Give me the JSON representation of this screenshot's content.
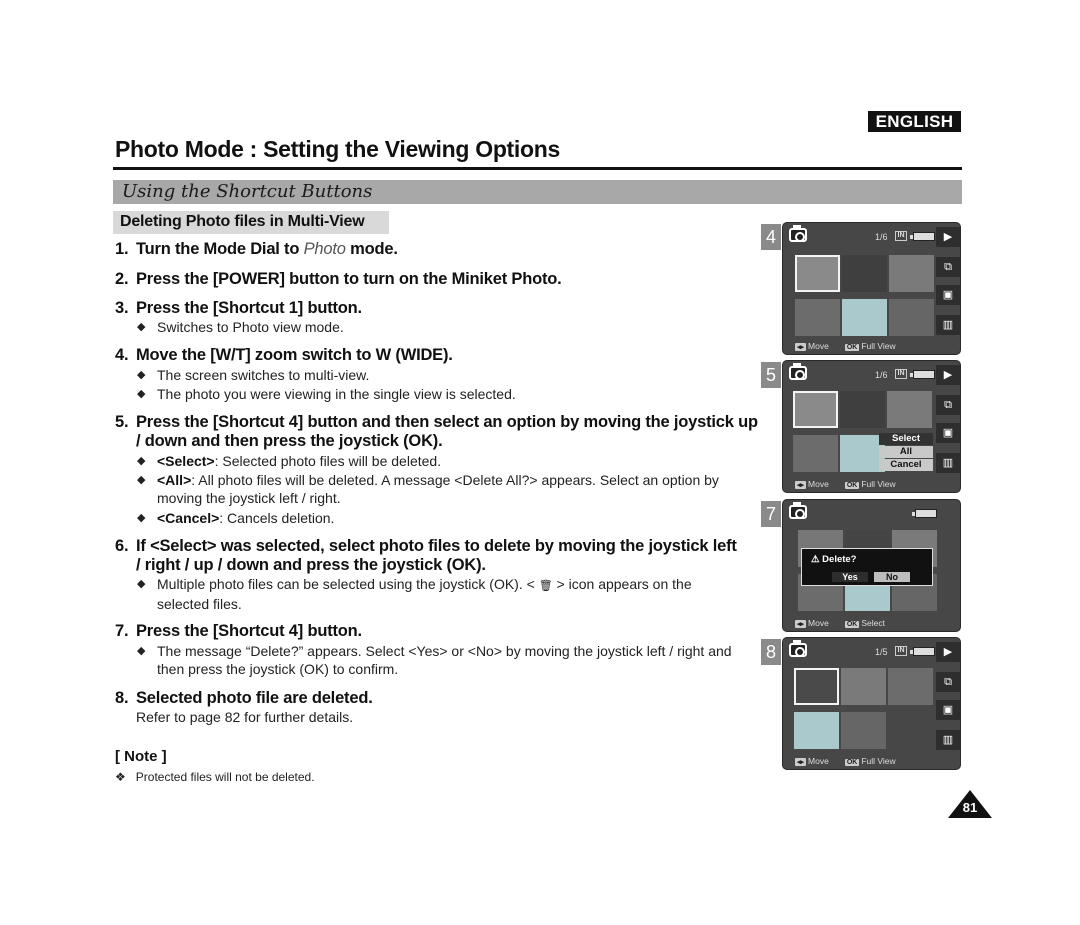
{
  "header": {
    "language_badge": "ENGLISH",
    "title": "Photo Mode : Setting the Viewing Options",
    "section": "Using the Shortcut Buttons",
    "subsection": "Deleting Photo files in Multi-View"
  },
  "steps": [
    {
      "num": "1.",
      "text_before": "Turn the Mode Dial to ",
      "text_italic": "Photo",
      "text_after": " mode."
    },
    {
      "num": "2.",
      "text": "Press the [POWER] button to turn on the Miniket Photo."
    },
    {
      "num": "3.",
      "text": "Press the [Shortcut 1] button.",
      "bullets": [
        {
          "text": "Switches to Photo view mode."
        }
      ]
    },
    {
      "num": "4.",
      "text": "Move the [W/T] zoom switch to W (WIDE).",
      "bullets": [
        {
          "text": "The screen switches to multi-view."
        },
        {
          "text": "The photo you were viewing in the single view is selected."
        }
      ]
    },
    {
      "num": "5.",
      "text": "Press the [Shortcut 4] button and then select an option by moving the joystick up / down and then press the joystick (OK).",
      "bullets": [
        {
          "bold": "<Select>",
          "text": ": Selected photo files will be deleted."
        },
        {
          "bold": "<All>",
          "text": ": All photo files will be deleted. A message <Delete All?> appears. Select an option by moving the joystick left / right."
        },
        {
          "bold": "<Cancel>",
          "text": ": Cancels deletion."
        }
      ]
    },
    {
      "num": "6.",
      "text": "If <Select> was selected, select photo files to delete by moving the joystick left / right / up / down and press the joystick (OK).",
      "bullets": [
        {
          "text_before": "Multiple photo files can be selected using the joystick (OK). < ",
          "icon": "trash-icon",
          "text_after": " > icon appears on the selected files."
        }
      ]
    },
    {
      "num": "7.",
      "text": "Press the [Shortcut 4] button.",
      "bullets": [
        {
          "text": "The message “Delete?” appears. Select <Yes> or <No> by moving the joystick left / right and then press the joystick (OK) to confirm."
        }
      ]
    },
    {
      "num": "8.",
      "text": "Selected photo file are deleted.",
      "detail": "Refer to page 82 for further details."
    }
  ],
  "note": {
    "heading": "[ Note ]",
    "items": [
      "Protected files will not be deleted."
    ]
  },
  "page_number": "81",
  "screens": [
    {
      "step": "4",
      "counter": "1/6",
      "storage": "IN",
      "footer_move": "Move",
      "footer_ok_key": "OK",
      "footer_ok": "Full View",
      "side_icons": [
        "play-icon",
        "slideshow-icon",
        "lock-icon",
        "trash-icon"
      ]
    },
    {
      "step": "5",
      "counter": "1/6",
      "storage": "IN",
      "footer_move": "Move",
      "footer_ok_key": "OK",
      "footer_ok": "Full View",
      "menu": [
        "Select",
        "All",
        "Cancel"
      ],
      "menu_selected": "Select"
    },
    {
      "step": "7",
      "dialog_title": "Delete?",
      "dialog_yes": "Yes",
      "dialog_no": "No",
      "dialog_selected": "No",
      "footer_move": "Move",
      "footer_ok_key": "OK",
      "footer_ok": "Select"
    },
    {
      "step": "8",
      "counter": "1/5",
      "storage": "IN",
      "footer_move": "Move",
      "footer_ok_key": "OK",
      "footer_ok": "Full View"
    }
  ],
  "icons": {
    "diamond": "◆",
    "cross": "❖",
    "warning": "⚠",
    "trash": "🗑",
    "play": "▶",
    "lock": "🔒"
  }
}
